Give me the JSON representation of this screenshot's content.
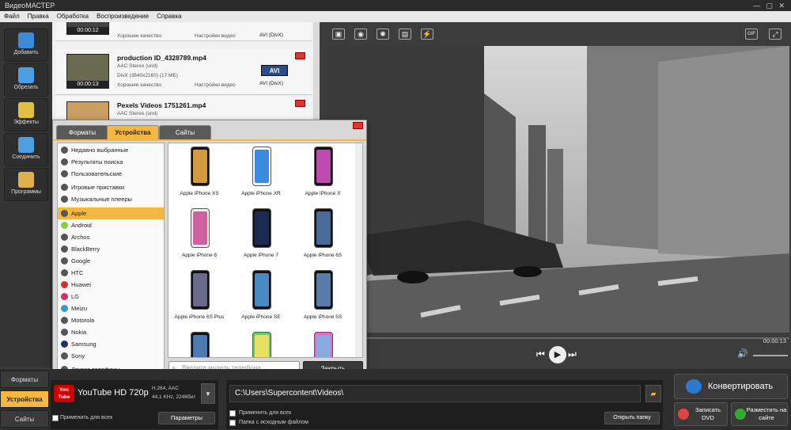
{
  "app": {
    "title": "ВидеоМАСТЕР"
  },
  "menu": [
    "Файл",
    "Правка",
    "Обработка",
    "Воспроизведение",
    "Справка"
  ],
  "sidebar": [
    {
      "label": "Добавить",
      "color": "#3c8ad8"
    },
    {
      "label": "Обрезать",
      "color": "#4aa0e0"
    },
    {
      "label": "Эффекты",
      "color": "#e0c040"
    },
    {
      "label": "Соединить",
      "color": "#4aa0e0"
    },
    {
      "label": "Программы",
      "color": "#e0b050"
    }
  ],
  "files": [
    {
      "name": "",
      "duration": "00:00:12",
      "audio": "",
      "video": "",
      "quality": "Хорошее качество",
      "settings": "Настройки видео",
      "format": "AVI (DivX)",
      "badge": ""
    },
    {
      "name": "production ID_4328789.mp4",
      "duration": "00:00:13",
      "audio": "AAC Stereo (und)",
      "video": "DivX (3840x2160) (17 МБ)",
      "quality": "Хорошее качество",
      "settings": "Настройки видео",
      "format": "AVI (DivX)",
      "badge": "AVI"
    },
    {
      "name": "Pexels Videos 1751261.mp4",
      "duration": "",
      "audio": "AAC Stereo (und)",
      "video": "",
      "quality": "",
      "settings": "",
      "format": "",
      "badge": ""
    }
  ],
  "dialog": {
    "tabs": [
      "Форматы",
      "Устройства",
      "Сайты"
    ],
    "active_tab": "Устройства",
    "categories": [
      "Недавно выбранные",
      "Результаты поиска",
      "Пользовательские",
      "Игровые приставки",
      "Музыкальные плееры",
      "Apple",
      "Android",
      "Archos",
      "BlackBerry",
      "Google",
      "HTC",
      "Huawei",
      "LG",
      "Meizu",
      "Motorola",
      "Nokia",
      "Samsung",
      "Sony",
      "Другие телефоны"
    ],
    "selected_category": "Apple",
    "devices": [
      "Apple iPhone XS",
      "Apple iPhone XR",
      "Apple iPhone X",
      "Apple iPhone 8",
      "Apple iPhone 7",
      "Apple iPhone 6S",
      "Apple iPhone 6S Plus",
      "Apple iPhone SE",
      "Apple iPhone 5S",
      "",
      "",
      ""
    ],
    "search_placeholder": "Введите модель телефона...",
    "close_label": "Закрыть"
  },
  "player": {
    "time": "00:00:13"
  },
  "bottom": {
    "tabs": [
      "Форматы",
      "Устройства",
      "Сайты"
    ],
    "active_tab": "Устройства",
    "profile": "YouTube HD 720p",
    "profile_info1": "H.264, AAC",
    "profile_info2": "44,1 KHz, 224Кбит",
    "apply_all": "Применить для всех",
    "params": "Параметры",
    "path": "C:\\Users\\Supercontent\\Videos\\",
    "apply_all2": "Применить для всех",
    "source_folder": "Папка с исходным файлом",
    "open_folder": "Открыть папку",
    "convert": "Конвертировать",
    "dvd": "Записать DVD",
    "web": "Разместить на сайте",
    "youtube_logo": "You Tube"
  }
}
